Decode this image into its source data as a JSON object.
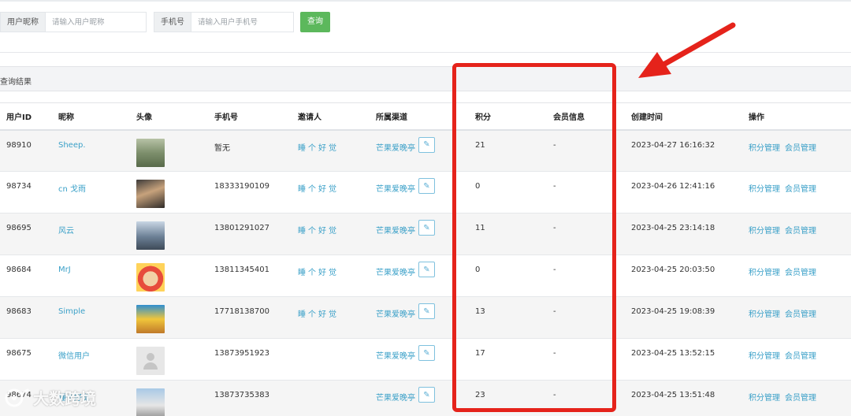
{
  "search": {
    "nickname_label": "用户昵称",
    "nickname_placeholder": "请输入用户昵称",
    "phone_label": "手机号",
    "phone_placeholder": "请输入用户手机号",
    "query_button": "查询"
  },
  "results": {
    "title": "查询结果"
  },
  "table": {
    "headers": [
      "用户ID",
      "昵称",
      "头像",
      "手机号",
      "邀请人",
      "所属渠道",
      "积分",
      "会员信息",
      "创建时间",
      "操作"
    ],
    "rows": [
      {
        "id": "98910",
        "nickname": "Sheep.",
        "phone": "暂无",
        "inviter": "睡个好觉",
        "channel": "芒果爱晚亭",
        "points": "21",
        "member": "-",
        "created": "2023-04-27 16:16:32"
      },
      {
        "id": "98734",
        "nickname": "cn 戈雨",
        "phone": "18333190109",
        "inviter": "睡个好觉",
        "channel": "芒果爱晚亭",
        "points": "0",
        "member": "-",
        "created": "2023-04-26 12:41:16"
      },
      {
        "id": "98695",
        "nickname": "风云",
        "phone": "13801291027",
        "inviter": "睡个好觉",
        "channel": "芒果爱晚亭",
        "points": "11",
        "member": "-",
        "created": "2023-04-25 23:14:18"
      },
      {
        "id": "98684",
        "nickname": "MrJ",
        "phone": "13811345401",
        "inviter": "睡个好觉",
        "channel": "芒果爱晚亭",
        "points": "0",
        "member": "-",
        "created": "2023-04-25 20:03:50"
      },
      {
        "id": "98683",
        "nickname": "Simple",
        "phone": "17718138700",
        "inviter": "睡个好觉",
        "channel": "芒果爱晚亭",
        "points": "13",
        "member": "-",
        "created": "2023-04-25 19:08:39"
      },
      {
        "id": "98675",
        "nickname": "微信用户",
        "phone": "13873951923",
        "inviter": "",
        "channel": "芒果爱晚亭",
        "points": "17",
        "member": "-",
        "created": "2023-04-25 13:52:15"
      },
      {
        "id": "98674",
        "nickname": "睡个好觉",
        "phone": "13873735383",
        "inviter": "",
        "channel": "芒果爱晚亭",
        "points": "23",
        "member": "-",
        "created": "2023-04-25 13:51:48"
      }
    ],
    "actions": {
      "points": "积分管理",
      "member": "会员管理"
    }
  },
  "watermark": "大数跨境",
  "colors": {
    "primary_button": "#5cb85c",
    "link": "#3aa0c8",
    "highlight": "#e5231b"
  }
}
